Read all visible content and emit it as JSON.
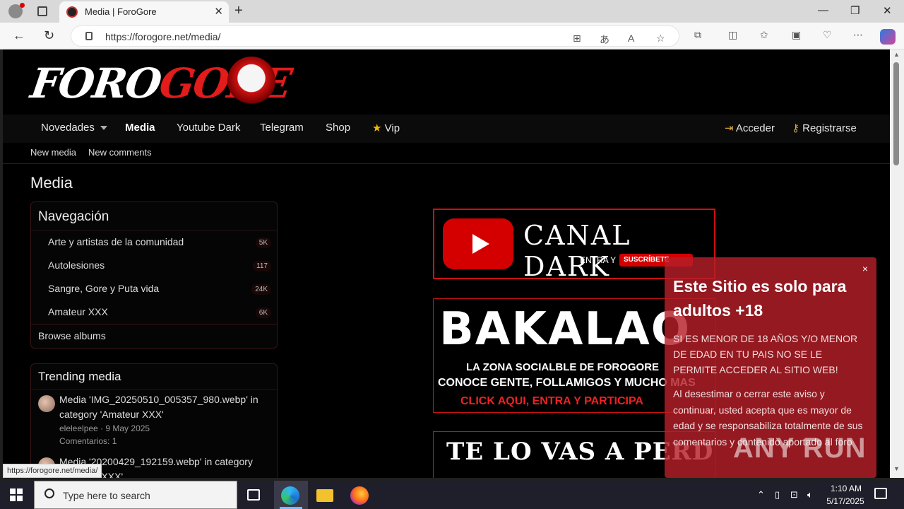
{
  "browser": {
    "tab_title": "Media | ForoGore",
    "url": "https://forogore.net/media/",
    "status_url": "https://forogore.net/media/"
  },
  "site": {
    "logo_part1": "FORO",
    "logo_part2": "GORE",
    "nav": {
      "items": [
        {
          "label": "Novedades"
        },
        {
          "label": "Media"
        },
        {
          "label": "Youtube Dark"
        },
        {
          "label": "Telegram"
        },
        {
          "label": "Shop"
        },
        {
          "label": "Vip"
        }
      ],
      "login": "Acceder",
      "register": "Registrarse"
    },
    "subnav": [
      "New media",
      "New comments"
    ],
    "page_title": "Media",
    "navigation": {
      "header": "Navegación",
      "categories": [
        {
          "label": "Arte y artistas de la comunidad",
          "count": "5K"
        },
        {
          "label": "Autolesiones",
          "count": "117"
        },
        {
          "label": "Sangre, Gore y Puta vida",
          "count": "24K"
        },
        {
          "label": "Amateur XXX",
          "count": "6K"
        }
      ],
      "browse": "Browse albums"
    },
    "trending": {
      "header": "Trending media",
      "items": [
        {
          "title": "Media 'IMG_20250510_005357_980.webp' in category 'Amateur XXX'",
          "meta": "eleleelpee · 9 May 2025",
          "comments": "Comentarios: 1"
        },
        {
          "title": "Media '20200429_192159.webp' in category 'Amateur XXX'",
          "meta": "",
          "comments": ""
        }
      ]
    },
    "banners": {
      "canal_dark": "CANAL DARK",
      "entra_y": "ENTRA Y",
      "suscribete": "SUSCRÍBETE",
      "bakalao": "BAKALAO",
      "bakalao_line1": "LA ZONA SOCIALBLE DE FOROGORE",
      "bakalao_line2": "CONOCE GENTE, FOLLAMIGOS Y MUCHO MAS",
      "bakalao_line3": "CLICK AQUI, ENTRA Y PARTICIPA",
      "perder": "TE LO VAS A PERDER?"
    },
    "popup": {
      "title": "Este Sitio es solo para adultos +18",
      "text1": "SI ES MENOR DE 18 AÑOS Y/O MENOR DE EDAD EN TU PAIS NO SE LE PERMITE ACCEDER AL SITIO WEB!",
      "text2": "Al desestimar o cerrar este aviso y continuar, usted acepta que es mayor de edad y se responsabiliza totalmente de sus comentarios y contenido aportado al foro",
      "close": "×"
    }
  },
  "watermark": "ANY RUN",
  "taskbar": {
    "search_placeholder": "Type here to search",
    "time": "1:10 AM",
    "date": "5/17/2025"
  },
  "colors": {
    "brand_red": "#e21b1b",
    "popup_bg": "#b41e28",
    "page_bg": "#000000"
  }
}
